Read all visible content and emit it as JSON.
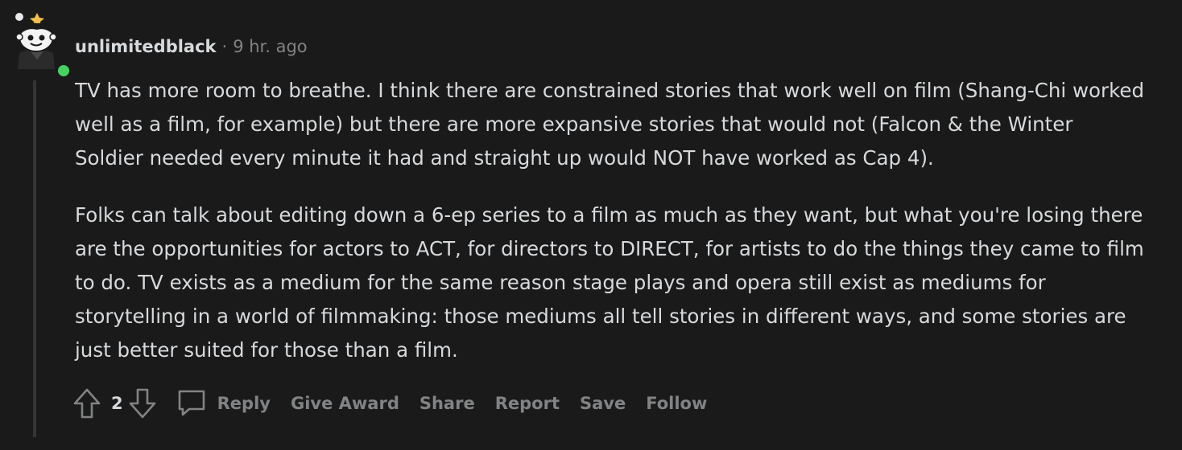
{
  "comment": {
    "author": "unlimitedblack",
    "separator": "·",
    "timestamp": "9 hr. ago",
    "avatar_icon": "snoo-avatar-icon",
    "online_status_color": "#46d160",
    "paragraphs": [
      "TV has more room to breathe. I think there are constrained stories that work well on film (Shang-Chi worked well as a film, for example) but there are more expansive stories that would not (Falcon & the Winter Soldier needed every minute it had and straight up would NOT have worked as Cap 4).",
      "Folks can talk about editing down a 6-ep series to a film as much as they want, but what you're losing there are the opportunities for actors to ACT, for directors to DIRECT, for artists to do the things they came to film to do. TV exists as a medium for the same reason stage plays and opera still exist as mediums for storytelling in a world of filmmaking: those mediums all tell stories in different ways, and some stories are just better suited for those than a film."
    ],
    "score": "2",
    "actions": {
      "upvote_icon": "upvote-arrow-icon",
      "downvote_icon": "downvote-arrow-icon",
      "reply_icon": "speech-bubble-icon",
      "reply": "Reply",
      "give_award": "Give Award",
      "share": "Share",
      "report": "Report",
      "save": "Save",
      "follow": "Follow"
    }
  },
  "colors": {
    "background": "#1a1a1b",
    "text": "#d7dadc",
    "muted": "#818384",
    "thread_line": "#343536"
  }
}
